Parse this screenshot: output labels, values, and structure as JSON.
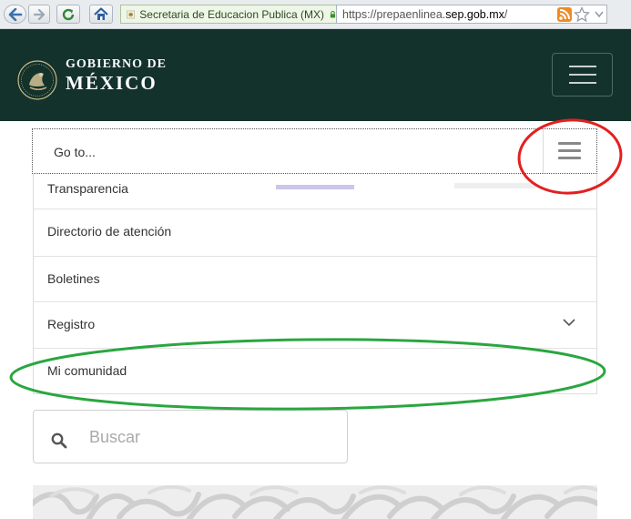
{
  "browser": {
    "identity_label": "Secretaria de Educacion Publica (MX)",
    "url_prefix": "https://prepaenlinea.",
    "url_domain": "sep.gob.mx",
    "url_suffix": "/"
  },
  "header": {
    "logo_line1": "GOBIERNO DE",
    "logo_line2": "MÉXICO"
  },
  "goto": {
    "label": "Go to..."
  },
  "menu": {
    "items": [
      {
        "label": "Transparencia"
      },
      {
        "label": "Directorio de atención"
      },
      {
        "label": "Boletines"
      },
      {
        "label": "Registro",
        "has_submenu": true
      },
      {
        "label": "Mi comunidad"
      }
    ]
  },
  "search": {
    "placeholder": "Buscar"
  },
  "colors": {
    "header_bg": "#13322b",
    "annotation_red": "#e32020",
    "annotation_green": "#2aa640"
  }
}
